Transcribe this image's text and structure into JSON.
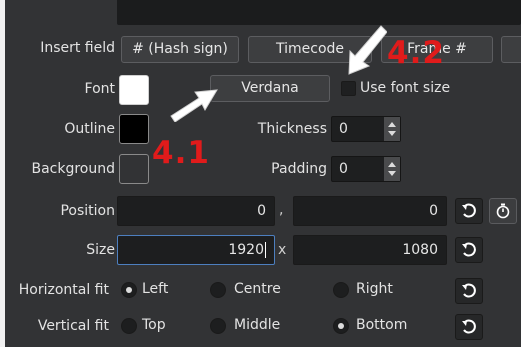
{
  "insert_field": {
    "label": "Insert field",
    "buttons": [
      "# (Hash sign)",
      "Timecode",
      "Frame #"
    ]
  },
  "font": {
    "label": "Font",
    "swatch_color": "#ffffff",
    "font_button": "Verdana",
    "use_font_size_label": "Use font size",
    "use_font_size_checked": false
  },
  "outline": {
    "label": "Outline",
    "swatch_color": "#000000",
    "thickness_label": "Thickness",
    "thickness_value": "0"
  },
  "background": {
    "label": "Background",
    "swatch_color": "#323335",
    "padding_label": "Padding",
    "padding_value": "0"
  },
  "position": {
    "label": "Position",
    "x": "0",
    "separator": ",",
    "y": "0"
  },
  "size": {
    "label": "Size",
    "width": "1920",
    "separator": "x",
    "height": "1080"
  },
  "horizontal_fit": {
    "label": "Horizontal fit",
    "options": [
      "Left",
      "Centre",
      "Right"
    ],
    "selected": "Left"
  },
  "vertical_fit": {
    "label": "Vertical fit",
    "options": [
      "Top",
      "Middle",
      "Bottom"
    ],
    "selected": "Bottom"
  },
  "annotations": {
    "label_a": "4.1",
    "label_b": "4.2",
    "color": "#e01b1b"
  },
  "icons": {
    "reset": "reset-icon",
    "timer": "timer-icon",
    "arrow": "arrow-icon"
  }
}
